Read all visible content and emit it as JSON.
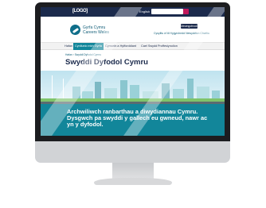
{
  "topbar": {
    "gov_logo": "[LOGO]",
    "language_link": "English",
    "search_placeholder": ""
  },
  "brand": {
    "name_line1": "Gyrfa Cymru",
    "name_line2": "Careers Wales",
    "login_label": "Mewngofnodi",
    "util_links": "Cysylltu â Ni   Hygyrchedd   Newyddion   Chwilio"
  },
  "nav": {
    "items": [
      {
        "label": "Hafan"
      },
      {
        "label": "Cynllunio eich Gyrfa"
      },
      {
        "label": "Cymorth a Hyfforddiant"
      },
      {
        "label": "Cael Swydd"
      },
      {
        "label": "Proffesiynolion"
      }
    ]
  },
  "breadcrumb": "Hafan  ›  Swyddi Dyfodol Cymru",
  "page": {
    "title": "Swyddi Dyfodol Cymru",
    "hero_text": "Archwiliwch ranbarthau a diwydiannau Cymru. Dysgwch pa swyddi y gallech eu gwneud, nawr ac yn y dyfodol."
  },
  "colors": {
    "navy": "#1b2a4c",
    "teal": "#12869a",
    "accent": "#c2185b"
  }
}
